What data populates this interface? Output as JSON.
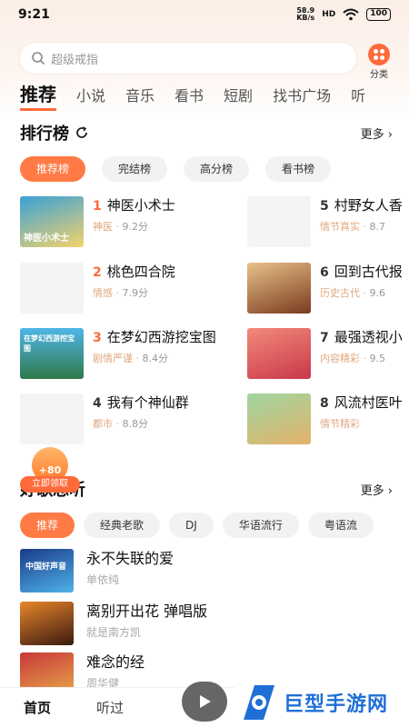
{
  "status": {
    "time": "9:21",
    "net_speed": "58.9",
    "net_unit": "KB/s",
    "signal": "HD",
    "battery": "100"
  },
  "search": {
    "placeholder": "超级戒指"
  },
  "category": {
    "label": "分类"
  },
  "tabs": [
    "推荐",
    "小说",
    "音乐",
    "看书",
    "短剧",
    "找书广场",
    "听"
  ],
  "ranking": {
    "title": "排行榜",
    "more": "更多",
    "pills": [
      "推荐榜",
      "完结榜",
      "高分榜",
      "看书榜"
    ],
    "items": [
      {
        "rank": "1",
        "title": "神医小术士",
        "tag": "神医",
        "score": "9.2分",
        "cover_text": "神医小术士"
      },
      {
        "rank": "2",
        "title": "桃色四合院",
        "tag": "情感",
        "score": "7.9分"
      },
      {
        "rank": "3",
        "title": "在梦幻西游挖宝图",
        "tag": "剧情严谨",
        "score": "8.4分",
        "cover_text": "在梦幻西游挖宝图"
      },
      {
        "rank": "4",
        "title": "我有个神仙群",
        "tag": "都市",
        "score": "8.8分"
      },
      {
        "rank": "5",
        "title": "村野女人香",
        "tag": "情节真实",
        "score": "8.7"
      },
      {
        "rank": "6",
        "title": "回到古代报",
        "tag": "历史古代",
        "score": "9.6"
      },
      {
        "rank": "7",
        "title": "最强透视小",
        "tag": "内容精彩",
        "score": "9.5"
      },
      {
        "rank": "8",
        "title": "风流村医叶",
        "tag": "情节精彩",
        "score": ""
      }
    ]
  },
  "float_reward": {
    "amount": "+80",
    "label": "立即领取"
  },
  "songs_section": {
    "title": "好歌总听",
    "more": "更多",
    "pills": [
      "推荐",
      "经典老歌",
      "DJ",
      "华语流行",
      "粤语流"
    ],
    "items": [
      {
        "title": "永不失联的爱",
        "artist": "单依纯",
        "cover_text": "中国好声音"
      },
      {
        "title": "离别开出花 弹唱版",
        "artist": "就是南方凯"
      },
      {
        "title": "难念的经",
        "artist": "周华健"
      }
    ]
  },
  "bottom_nav": {
    "home": "首页",
    "listened": "听过"
  },
  "watermark": {
    "text": "巨型手游网"
  },
  "colors": {
    "accent": "#ff6a3a",
    "watermark_blue": "#1f6fd6"
  }
}
